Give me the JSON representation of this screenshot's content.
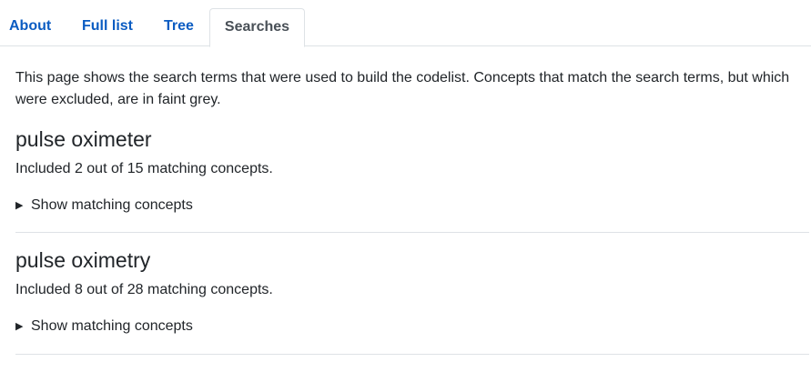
{
  "tabs": [
    {
      "label": "About"
    },
    {
      "label": "Full list"
    },
    {
      "label": "Tree"
    },
    {
      "label": "Searches",
      "active": true
    }
  ],
  "intro": "This page shows the search terms that were used to build the codelist. Concepts that match the search terms, but which were excluded, are in faint grey.",
  "searches": [
    {
      "term": "pulse oximeter",
      "summary": "Included 2 out of 15 matching concepts.",
      "toggle_label": "Show matching concepts",
      "toggle_icon": "triangle-right-icon"
    },
    {
      "term": "pulse oximetry",
      "summary": "Included 8 out of 28 matching concepts.",
      "toggle_label": "Show matching concepts",
      "toggle_icon": "triangle-right-icon"
    }
  ],
  "colors": {
    "link": "#0b5cc2",
    "active_tab_text": "#495057",
    "text": "#212529",
    "border": "#dee2e6"
  }
}
